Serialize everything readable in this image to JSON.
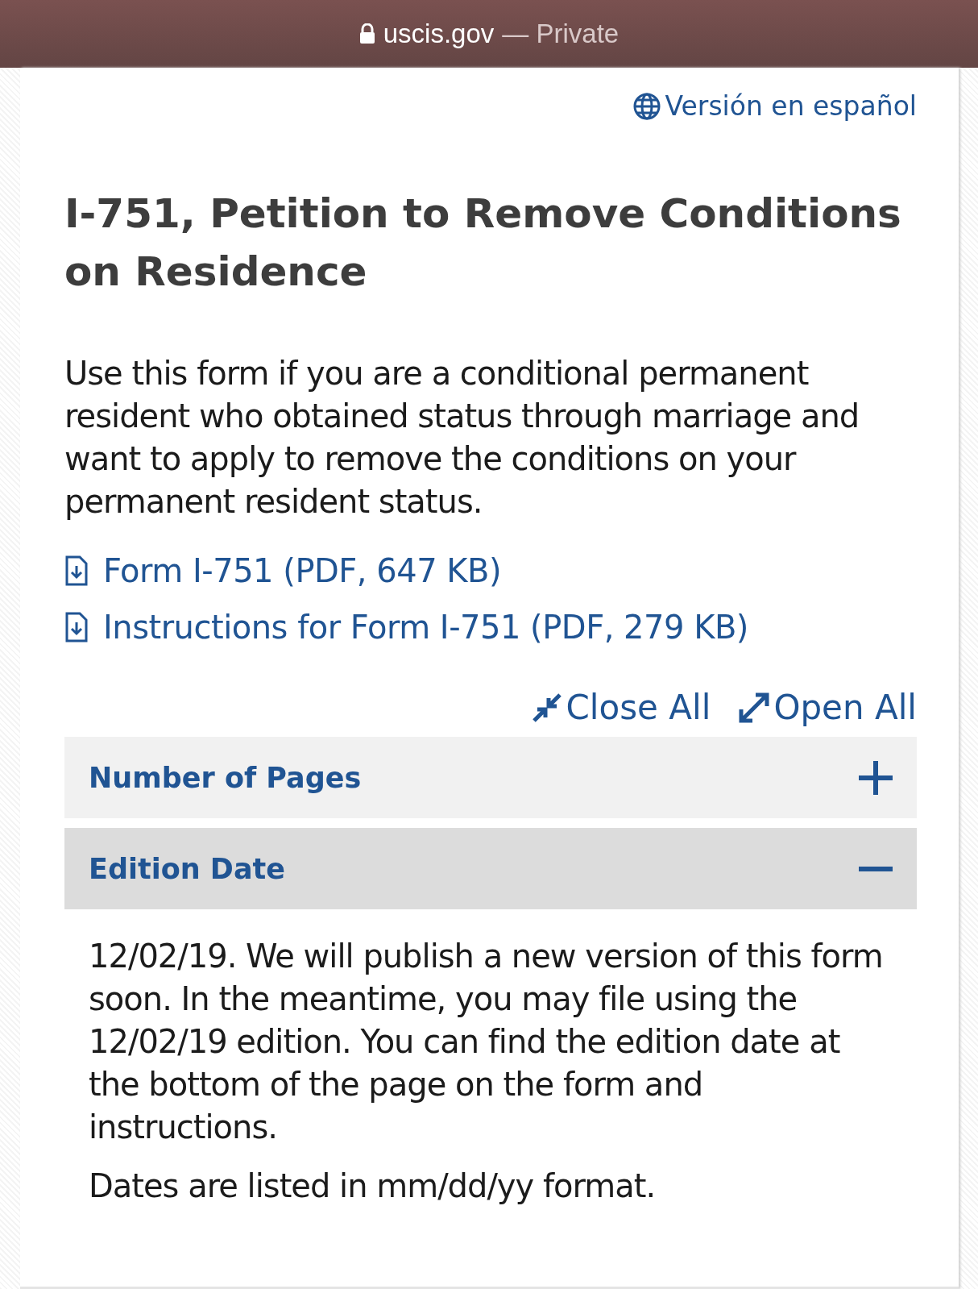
{
  "browser_bar": {
    "domain": "uscis.gov",
    "separator": "—",
    "mode": "Private"
  },
  "language_link": "Versión en español",
  "title": "I-751, Petition to Remove Conditions on Residence",
  "intro": "Use this form if you are a conditional permanent resident who obtained status through marriage and want to apply to remove the conditions on your permanent resident status.",
  "downloads": [
    {
      "label": "Form I-751 (PDF, 647 KB)"
    },
    {
      "label": "Instructions for Form I-751 (PDF, 279 KB)"
    }
  ],
  "accordion_controls": [
    {
      "label": "Close All",
      "kind": "close"
    },
    {
      "label": "Open All",
      "kind": "open"
    }
  ],
  "accordion": [
    {
      "title": "Number of Pages",
      "expanded": false
    },
    {
      "title": "Edition Date",
      "expanded": true,
      "paragraphs": [
        "12/02/19. We will publish a new version of this form soon. In the meantime, you may file using the 12/02/19 edition. You can find the edition date at the bottom of the page on the form and instructions.",
        "Dates are listed in mm/dd/yy format."
      ]
    }
  ]
}
